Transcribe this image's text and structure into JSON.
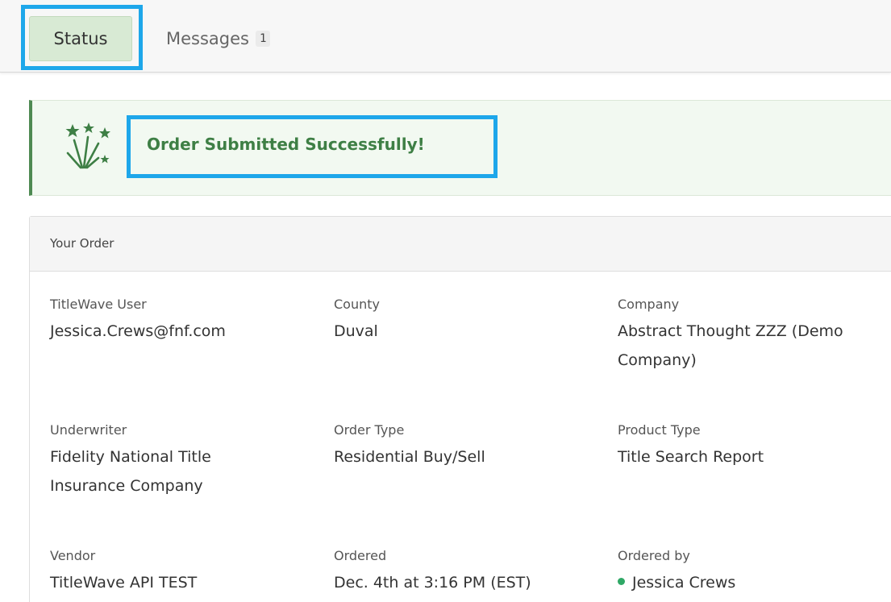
{
  "tabs": {
    "status": {
      "label": "Status"
    },
    "messages": {
      "label": "Messages",
      "badge": "1"
    }
  },
  "banner": {
    "icon": "fireworks-icon",
    "message": "Order Submitted Successfully!"
  },
  "order": {
    "title": "Your Order",
    "fields": {
      "titlewave_user": {
        "label": "TitleWave User",
        "value": "Jessica.Crews@fnf.com"
      },
      "county": {
        "label": "County",
        "value": "Duval"
      },
      "company": {
        "label": "Company",
        "value": "Abstract Thought ZZZ (Demo Company)"
      },
      "underwriter": {
        "label": "Underwriter",
        "value": "Fidelity National Title Insurance Company"
      },
      "order_type": {
        "label": "Order Type",
        "value": "Residential Buy/Sell"
      },
      "product_type": {
        "label": "Product Type",
        "value": "Title Search Report"
      },
      "vendor": {
        "label": "Vendor",
        "value": "TitleWave API TEST"
      },
      "ordered": {
        "label": "Ordered",
        "value": "Dec. 4th at 3:16 PM (EST)"
      },
      "ordered_by": {
        "label": "Ordered by",
        "value": "Jessica Crews",
        "status_color": "#2fa866"
      }
    }
  },
  "colors": {
    "highlight": "#1ea7ea",
    "success_text": "#3e7f45",
    "active_tab": "#d8ead4"
  }
}
